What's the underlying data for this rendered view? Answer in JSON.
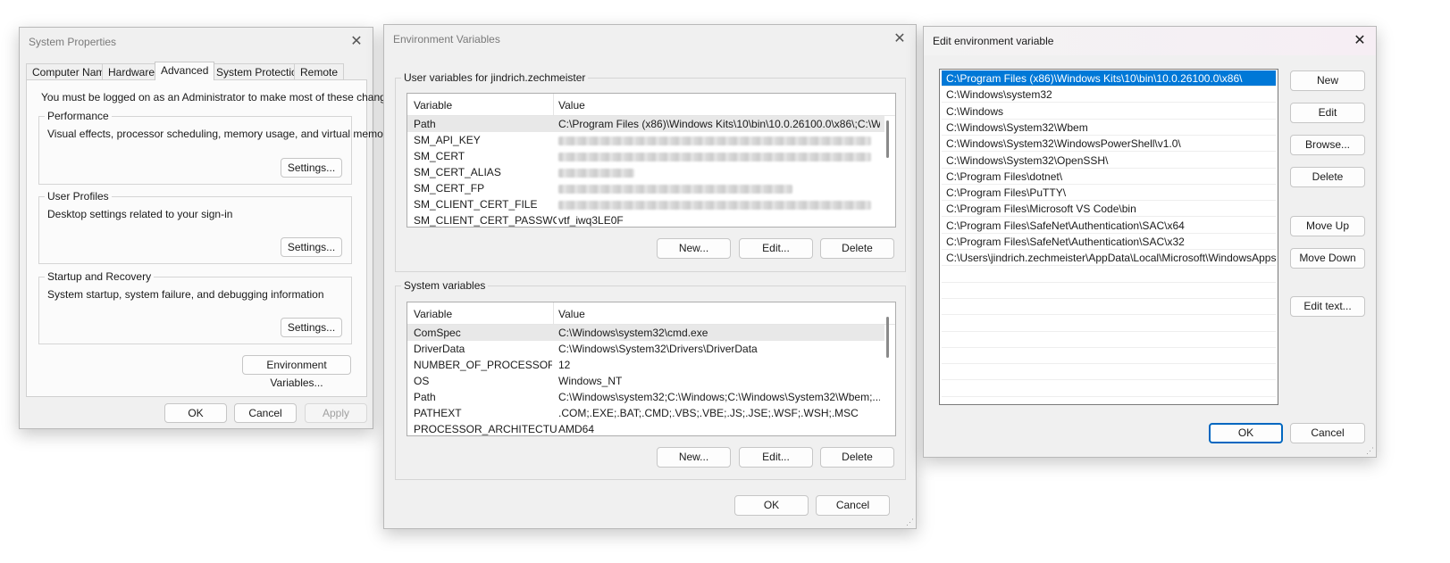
{
  "sys_props": {
    "title": "System Properties",
    "tabs": [
      "Computer Name",
      "Hardware",
      "Advanced",
      "System Protection",
      "Remote"
    ],
    "selected_tab": "Advanced",
    "admin_note": "You must be logged on as an Administrator to make most of these changes.",
    "performance": {
      "label": "Performance",
      "desc": "Visual effects, processor scheduling, memory usage, and virtual memory",
      "button": "Settings..."
    },
    "user_profiles": {
      "label": "User Profiles",
      "desc": "Desktop settings related to your sign-in",
      "button": "Settings..."
    },
    "startup": {
      "label": "Startup and Recovery",
      "desc": "System startup, system failure, and debugging information",
      "button": "Settings..."
    },
    "env_button": "Environment Variables...",
    "ok": "OK",
    "cancel": "Cancel",
    "apply": "Apply"
  },
  "env_vars": {
    "title": "Environment Variables",
    "user_group": "User variables for jindrich.zechmeister",
    "system_group": "System variables",
    "col_variable": "Variable",
    "col_value": "Value",
    "user_vars": [
      {
        "name": "Path",
        "value": "C:\\Program Files (x86)\\Windows Kits\\10\\bin\\10.0.26100.0\\x86\\;C:\\W..."
      },
      {
        "name": "SM_API_KEY",
        "value": ""
      },
      {
        "name": "SM_CERT",
        "value": ""
      },
      {
        "name": "SM_CERT_ALIAS",
        "value": ""
      },
      {
        "name": "SM_CERT_FP",
        "value": ""
      },
      {
        "name": "SM_CLIENT_CERT_FILE",
        "value": ""
      },
      {
        "name": "SM_CLIENT_CERT_PASSWORD",
        "value": "vtf_iwq3LE0F"
      }
    ],
    "system_vars": [
      {
        "name": "ComSpec",
        "value": "C:\\Windows\\system32\\cmd.exe"
      },
      {
        "name": "DriverData",
        "value": "C:\\Windows\\System32\\Drivers\\DriverData"
      },
      {
        "name": "NUMBER_OF_PROCESSORS",
        "value": "12"
      },
      {
        "name": "OS",
        "value": "Windows_NT"
      },
      {
        "name": "Path",
        "value": "C:\\Windows\\system32;C:\\Windows;C:\\Windows\\System32\\Wbem;..."
      },
      {
        "name": "PATHEXT",
        "value": ".COM;.EXE;.BAT;.CMD;.VBS;.VBE;.JS;.JSE;.WSF;.WSH;.MSC"
      },
      {
        "name": "PROCESSOR_ARCHITECTURE",
        "value": "AMD64"
      }
    ],
    "new": "New...",
    "edit": "Edit...",
    "delete": "Delete",
    "ok": "OK",
    "cancel": "Cancel"
  },
  "edit_env": {
    "title": "Edit environment variable",
    "entries": [
      "C:\\Program Files (x86)\\Windows Kits\\10\\bin\\10.0.26100.0\\x86\\",
      "C:\\Windows\\system32",
      "C:\\Windows",
      "C:\\Windows\\System32\\Wbem",
      "C:\\Windows\\System32\\WindowsPowerShell\\v1.0\\",
      "C:\\Windows\\System32\\OpenSSH\\",
      "C:\\Program Files\\dotnet\\",
      "C:\\Program Files\\PuTTY\\",
      "C:\\Program Files\\Microsoft VS Code\\bin",
      "C:\\Program Files\\SafeNet\\Authentication\\SAC\\x64",
      "C:\\Program Files\\SafeNet\\Authentication\\SAC\\x32",
      "C:\\Users\\jindrich.zechmeister\\AppData\\Local\\Microsoft\\WindowsApps"
    ],
    "buttons": {
      "new": "New",
      "edit": "Edit",
      "browse": "Browse...",
      "delete": "Delete",
      "move_up": "Move Up",
      "move_down": "Move Down",
      "edit_text": "Edit text...",
      "ok": "OK",
      "cancel": "Cancel"
    }
  },
  "colors": {
    "selection": "#0078d7",
    "accent_border": "#0067c0"
  }
}
